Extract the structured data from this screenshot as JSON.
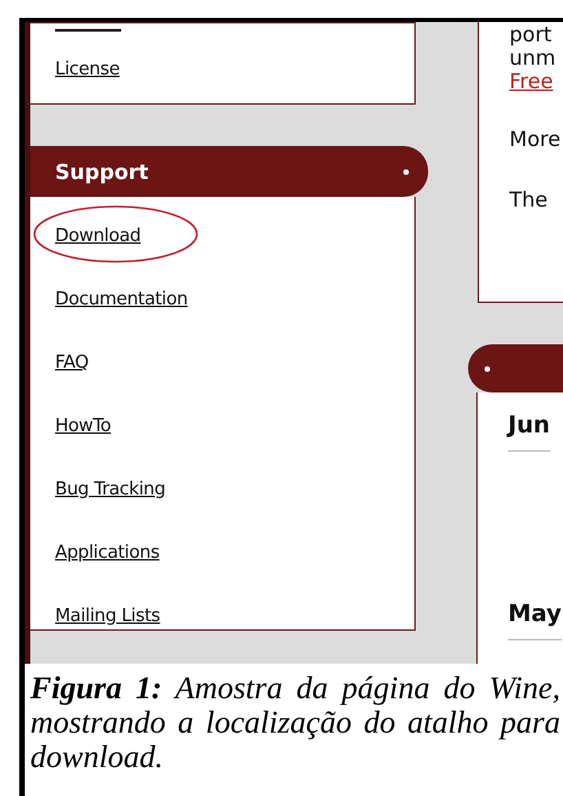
{
  "sidebar": {
    "top_items": [
      {
        "label": "License"
      }
    ],
    "section": {
      "title": "Support",
      "items": [
        {
          "label": "Download",
          "circled": true
        },
        {
          "label": "Documentation",
          "circled": false
        },
        {
          "label": "FAQ",
          "circled": false
        },
        {
          "label": "HowTo",
          "circled": false
        },
        {
          "label": "Bug Tracking",
          "circled": false
        },
        {
          "label": "Applications",
          "circled": false
        },
        {
          "label": "Mailing Lists",
          "circled": false
        }
      ]
    }
  },
  "content": {
    "top_lines": [
      {
        "text": "port",
        "kind": "text"
      },
      {
        "text": "unm",
        "kind": "text"
      },
      {
        "text": "Free",
        "kind": "link"
      }
    ],
    "paragraphs": [
      "More",
      "The"
    ],
    "news_headings": [
      "Jun",
      "May"
    ]
  },
  "caption": "**Figura 1:** Amostra da página do Wine, mostrando a localização do atalho para download."
}
